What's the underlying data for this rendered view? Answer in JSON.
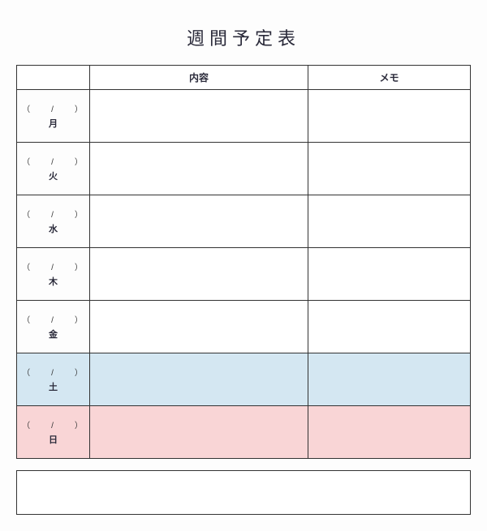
{
  "title": "週間予定表",
  "headers": {
    "day": "",
    "content": "内容",
    "memo": "メモ"
  },
  "date_template": "（　　/　　）",
  "days": [
    {
      "name": "月",
      "class": "",
      "content": "",
      "memo": ""
    },
    {
      "name": "火",
      "class": "",
      "content": "",
      "memo": ""
    },
    {
      "name": "水",
      "class": "",
      "content": "",
      "memo": ""
    },
    {
      "name": "木",
      "class": "",
      "content": "",
      "memo": ""
    },
    {
      "name": "金",
      "class": "",
      "content": "",
      "memo": ""
    },
    {
      "name": "土",
      "class": "sat",
      "content": "",
      "memo": ""
    },
    {
      "name": "日",
      "class": "sun",
      "content": "",
      "memo": ""
    }
  ],
  "notes": ""
}
